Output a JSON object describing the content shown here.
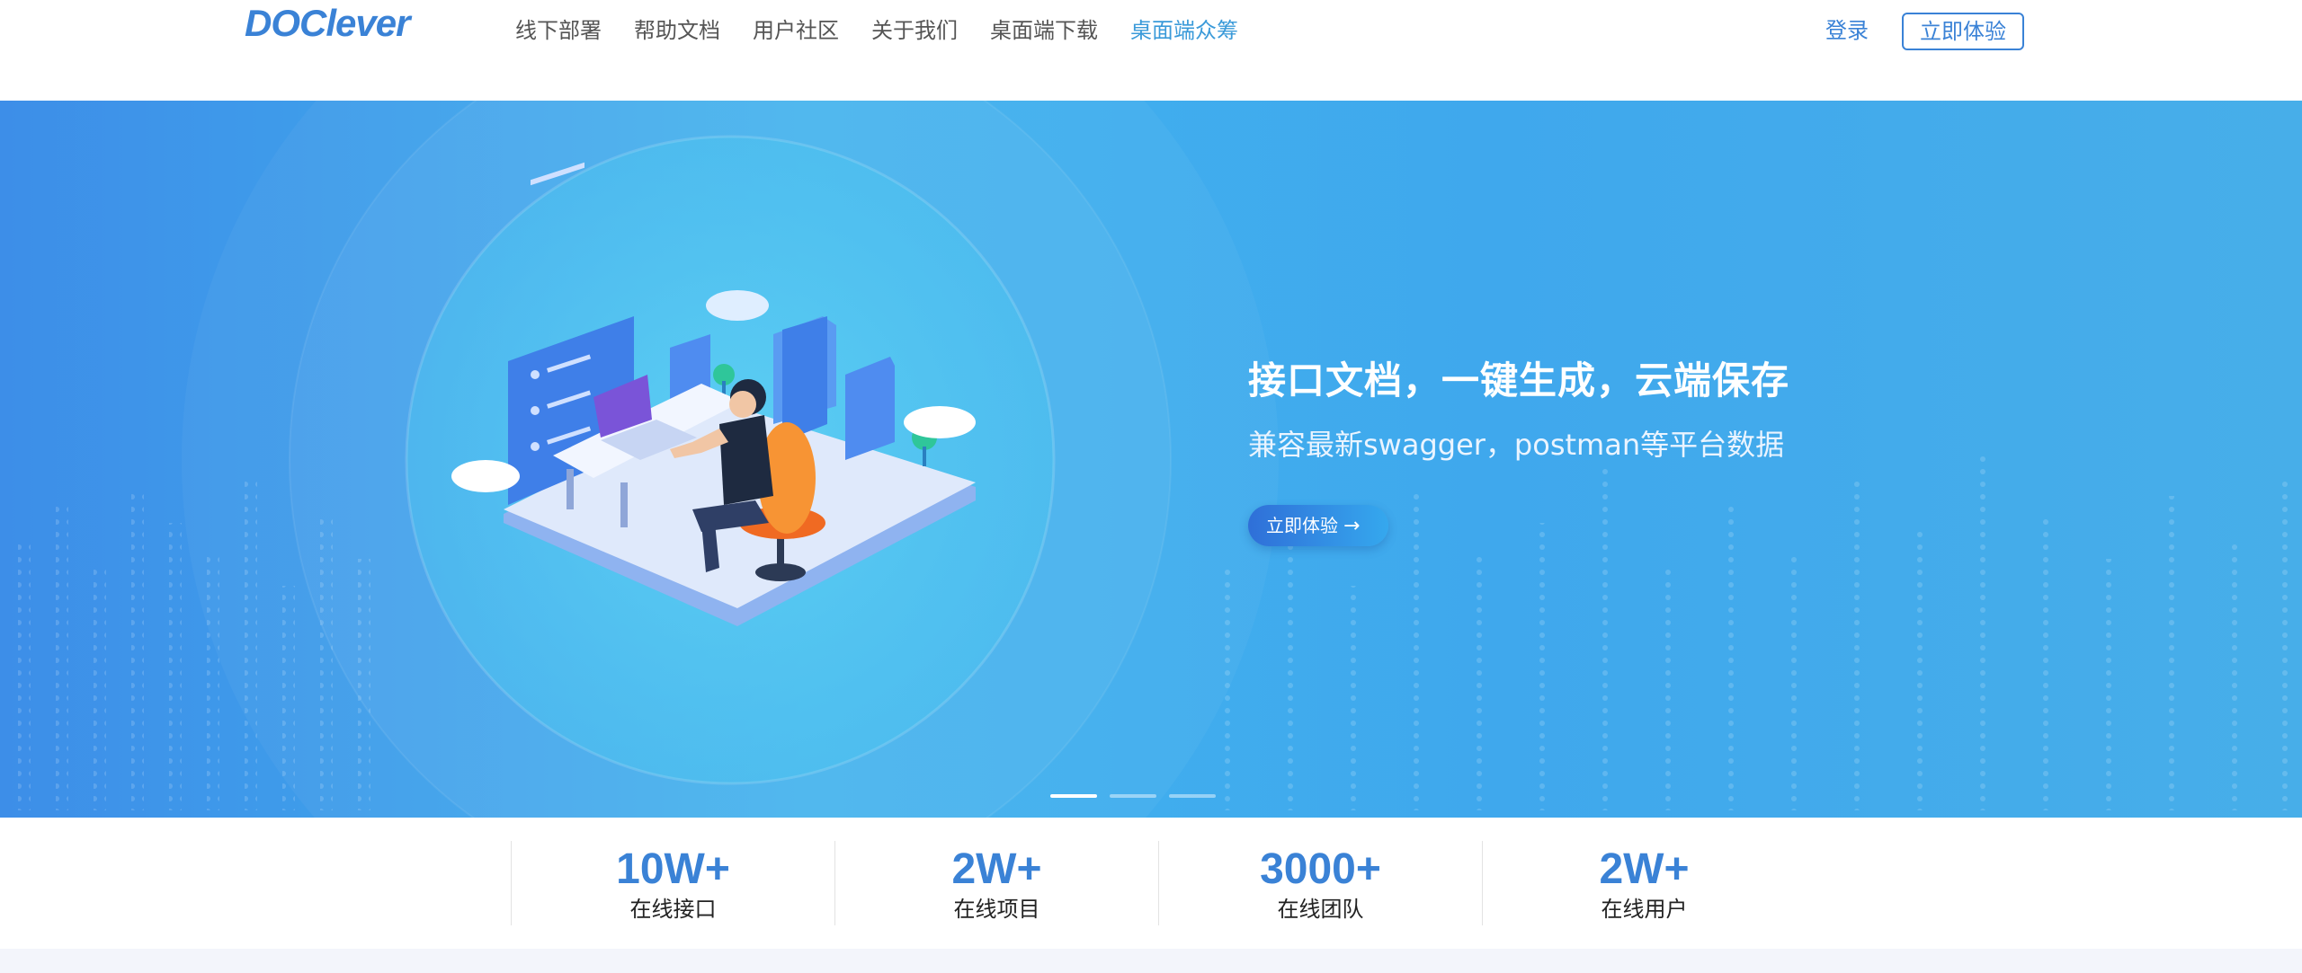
{
  "brand": {
    "logo_text": "DOClever",
    "accent": "#3a82d6"
  },
  "nav": {
    "items": [
      {
        "label": "线下部署"
      },
      {
        "label": "帮助文档"
      },
      {
        "label": "用户社区"
      },
      {
        "label": "关于我们"
      },
      {
        "label": "桌面端下载"
      },
      {
        "label": "桌面端众筹",
        "active": true
      }
    ]
  },
  "header": {
    "login_label": "登录",
    "trial_label": "立即体验"
  },
  "banner": {
    "title": "接口文档，一键生成，云端保存",
    "subtitle": "兼容最新swagger，postman等平台数据",
    "button_label": "立即体验",
    "button_icon": "arrow-right-icon",
    "illustration": "person-at-desk-with-laptop-illustration",
    "slide_count": 3,
    "active_slide": 1
  },
  "stats": [
    {
      "value": "10W+",
      "label": "在线接口"
    },
    {
      "value": "2W+",
      "label": "在线项目"
    },
    {
      "value": "3000+",
      "label": "在线团队"
    },
    {
      "value": "2W+",
      "label": "在线用户"
    }
  ]
}
